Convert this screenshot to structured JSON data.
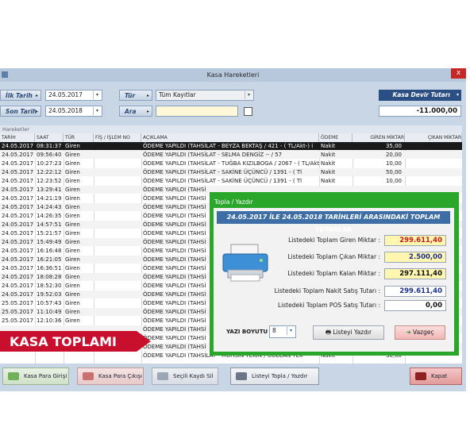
{
  "window": {
    "title": "Kasa Hareketleri",
    "close": "x"
  },
  "filters": {
    "ilk_tarih_label": "İlk Tarih",
    "ilk_tarih_value": "24.05.2017",
    "son_tarih_label": "Son Tarih",
    "son_tarih_value": "24.05.2018",
    "tur_label": "Tür",
    "tur_value": "Tüm Kayıtlar",
    "ara_label": "Ara"
  },
  "devir": {
    "label": "Kasa Devir Tutarı",
    "value": "-11.000,00"
  },
  "grid": {
    "caption": "Hareketler",
    "columns": [
      "TARİH",
      "SAAT",
      "TÜR",
      "FİŞ / İŞLEM NO",
      "AÇIKLAMA",
      "ÖDEME ŞEKLİ",
      "GİREN MİKTAR",
      "ÇIKAN MİKTAR"
    ],
    "rows": [
      [
        "24.05.2017",
        "08:31:37",
        "Giren",
        "",
        "ÖDEME YAPILDI (TAHSİLAT - BEYZA BEKTAŞ / 421 - ( TL/Akt-) i",
        "Nakit",
        "35,00",
        ""
      ],
      [
        "24.05.2017",
        "09:56:40",
        "Giren",
        "",
        "ÖDEME YAPILDI (TAHSİLAT - SELMA DENGİZ               -- / 57",
        "Nakit",
        "20,00",
        ""
      ],
      [
        "24.05.2017",
        "10:27:23",
        "Giren",
        "",
        "ÖDEME YAPILDI (TAHSİLAT - TUĞBA KIZILBOGA / 2067 - ( TL/Akt",
        "Nakit",
        "10,00",
        ""
      ],
      [
        "24.05.2017",
        "12:22:12",
        "Giren",
        "",
        "ÖDEME YAPILDI (TAHSİLAT - SAKİNE ÜÇÜNCÜ         / 1391 - ( Tl",
        "Nakit",
        "50,00",
        ""
      ],
      [
        "24.05.2017",
        "12:23:52",
        "Giren",
        "",
        "ÖDEME YAPILDI (TAHSİLAT - SAKİNE ÜÇÜNCÜ         / 1391 - ( Tl",
        "Nakit",
        "10,00",
        ""
      ],
      [
        "24.05.2017",
        "13:29:41",
        "Giren",
        "",
        "ÖDEME YAPILDI (TAHSİ",
        "",
        "",
        ""
      ],
      [
        "24.05.2017",
        "14:21:19",
        "Giren",
        "",
        "ÖDEME YAPILDI (TAHSİ",
        "",
        "",
        ""
      ],
      [
        "24.05.2017",
        "14:24:43",
        "Giren",
        "",
        "ÖDEME YAPILDI (TAHSİ",
        "",
        "",
        ""
      ],
      [
        "24.05.2017",
        "14:26:35",
        "Giren",
        "",
        "ÖDEME YAPILDI (TAHSİ",
        "",
        "",
        ""
      ],
      [
        "24.05.2017",
        "14:57:51",
        "Giren",
        "",
        "ÖDEME YAPILDI (TAHSİ",
        "",
        "",
        ""
      ],
      [
        "24.05.2017",
        "15:21:57",
        "Giren",
        "",
        "ÖDEME YAPILDI (TAHSİ",
        "",
        "",
        ""
      ],
      [
        "24.05.2017",
        "15:49:49",
        "Giren",
        "",
        "ÖDEME YAPILDI (TAHSİ",
        "",
        "",
        ""
      ],
      [
        "24.05.2017",
        "16:16:48",
        "Giren",
        "",
        "ÖDEME YAPILDI (TAHSİ",
        "",
        "",
        ""
      ],
      [
        "24.05.2017",
        "16:21:05",
        "Giren",
        "",
        "ÖDEME YAPILDI (TAHSİ",
        "",
        "",
        ""
      ],
      [
        "24.05.2017",
        "16:36:51",
        "Giren",
        "",
        "ÖDEME YAPILDI (TAHSİ",
        "",
        "",
        ""
      ],
      [
        "24.05.2017",
        "18:08:28",
        "Giren",
        "",
        "ÖDEME YAPILDI (TAHSİ",
        "",
        "",
        ""
      ],
      [
        "24.05.2017",
        "18:52:30",
        "Giren",
        "",
        "ÖDEME YAPILDI (TAHSİ",
        "",
        "",
        ""
      ],
      [
        "24.05.2017",
        "19:52:03",
        "Giren",
        "",
        "ÖDEME YAPILDI (TAHSİ",
        "",
        "",
        ""
      ],
      [
        "25.05.2017",
        "10:57:43",
        "Giren",
        "",
        "ÖDEME YAPILDI (TAHSİ",
        "",
        "",
        ""
      ],
      [
        "25.05.2017",
        "11:10:49",
        "Giren",
        "",
        "ÖDEME YAPILDI (TAHSİ",
        "",
        "",
        ""
      ],
      [
        "25.05.2017",
        "12:10:36",
        "Giren",
        "",
        "ÖDEME YAPILDI (TAHSİ",
        "",
        "",
        ""
      ],
      [
        "",
        "",
        "",
        "",
        "ÖDEME YAPILDI (TAHSİ",
        "",
        "",
        ""
      ],
      [
        "",
        "",
        "",
        "",
        "ÖDEME YAPILDI (TAHSİ",
        "",
        "",
        ""
      ],
      [
        "",
        "",
        "",
        "",
        "ÖDEME YAPILDI (TAHSİ",
        "",
        "",
        ""
      ],
      [
        "",
        "",
        "",
        "",
        "ÖDEME YAPILDI (TAHSİLAT - MÜHSİN TEKİN     / GÜLCAN TEK",
        "Nakit",
        "30,00",
        ""
      ]
    ]
  },
  "bottom_buttons": {
    "giris": "Kasa Para Girişi",
    "cikis": "Kasa Para Çıkışı",
    "sil": "Seçili Kaydı Sil",
    "topla": "Listeyi Topla / Yazdır",
    "kapat": "Kapat"
  },
  "promo": {
    "text": "KASA TOPLAMI"
  },
  "dialog": {
    "title": "Topla / Yazdır",
    "banner": "24.05.2017 İLE 24.05.2018 TARİHLERİ ARASINDAKİ TOPLAM TUTARLAR",
    "lines": [
      {
        "label": "Listedeki Toplam Giren Miktar :",
        "value": "299.611,40"
      },
      {
        "label": "Listedeki Toplam Çıkan Miktar :",
        "value": "2.500,00"
      },
      {
        "label": "Listedeki Toplam Kalan Miktar :",
        "value": "297.111,40"
      },
      {
        "label": "Listedeki Toplam Nakit Satış Tutarı :",
        "value": "299.611,40"
      },
      {
        "label": "Listedeki Toplam POS Satış Tutarı :",
        "value": "0,00"
      }
    ],
    "font_label": "YAZI BOYUTU :",
    "font_value": "8",
    "print_button": "Listeyi Yazdır",
    "cancel_button": "Vazgeç"
  },
  "colors": {
    "accent": "#2aa62a",
    "banner_red": "#c8102e",
    "header_blue": "#2b4f82"
  }
}
